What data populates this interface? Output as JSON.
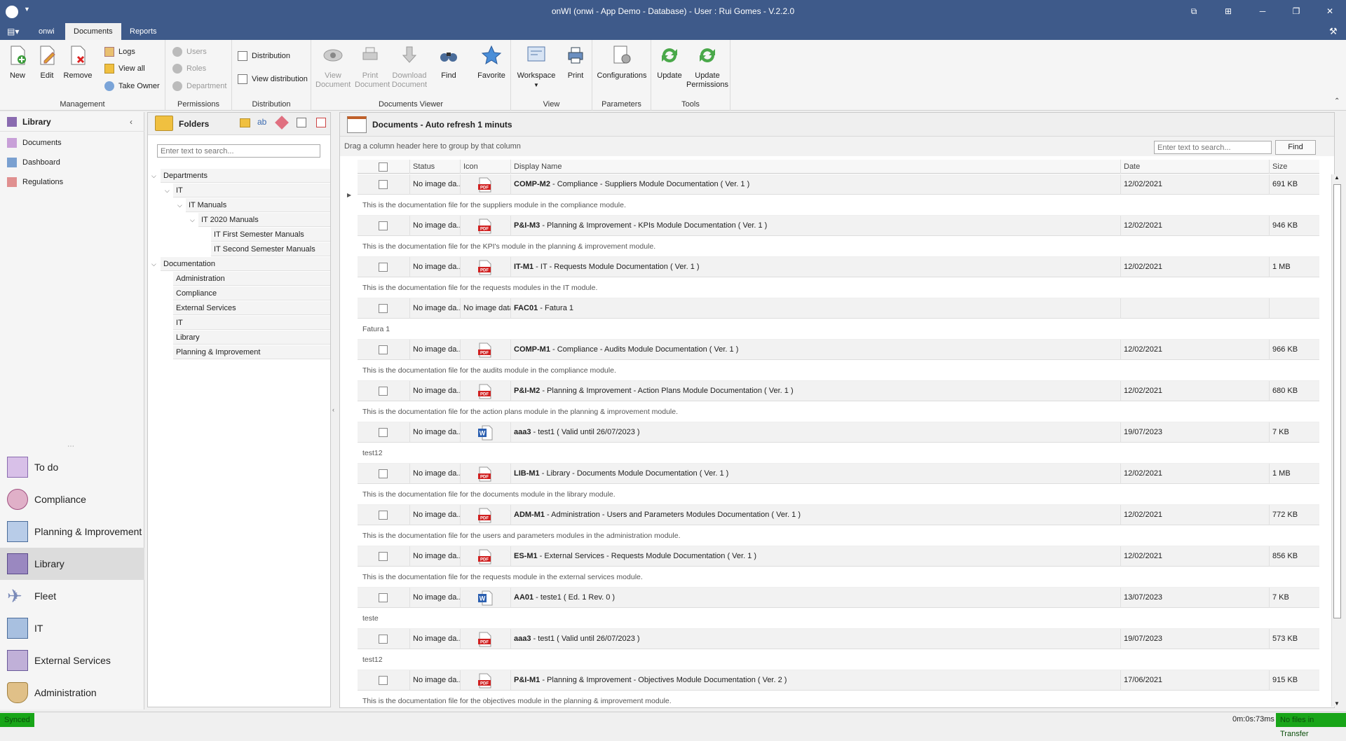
{
  "window": {
    "title": "onWI (onwi - App Demo - Database) - User : Rui Gomes - V.2.2.0"
  },
  "menu_tabs": [
    "onwi",
    "Documents",
    "Reports"
  ],
  "ribbon": {
    "management": {
      "name": "Management",
      "new": "New",
      "edit": "Edit",
      "remove": "Remove",
      "logs": "Logs",
      "view_all": "View all",
      "take_owner": "Take Owner"
    },
    "permissions": {
      "name": "Permissions",
      "users": "Users",
      "roles": "Roles",
      "department": "Department"
    },
    "distribution": {
      "name": "Distribution",
      "distribution": "Distribution",
      "view_distribution": "View distribution"
    },
    "viewer": {
      "name": "Documents Viewer",
      "view": "View\nDocument",
      "print": "Print\nDocument",
      "download": "Download\nDocument",
      "find": "Find",
      "favorite": "Favorite"
    },
    "view": {
      "name": "View",
      "workspace": "Workspace",
      "print": "Print"
    },
    "parameters": {
      "name": "Parameters",
      "configurations": "Configurations"
    },
    "tools": {
      "name": "Tools",
      "update": "Update",
      "update_permissions": "Update\nPermissions"
    }
  },
  "library": {
    "title": "Library",
    "items": [
      "Documents",
      "Dashboard",
      "Regulations"
    ]
  },
  "nav": [
    "To do",
    "Compliance",
    "Planning & Improvement",
    "Library",
    "Fleet",
    "IT",
    "External Services",
    "Administration"
  ],
  "folders": {
    "title": "Folders",
    "search_placeholder": "Enter text to search...",
    "tree": [
      "Departments",
      "IT",
      "IT Manuals",
      "IT 2020 Manuals",
      "IT First Semester Manuals",
      "IT Second Semester Manuals",
      "Documentation",
      "Administration",
      "Compliance",
      "External Services",
      "IT",
      "Library",
      "Planning & Improvement"
    ]
  },
  "documents": {
    "title": "Documents - Auto refresh 1 minuts",
    "group_hint": "Drag a column header here to group by that column",
    "search_placeholder": "Enter text to search...",
    "find": "Find",
    "columns": [
      "Status",
      "Icon",
      "Display Name",
      "Date",
      "Size"
    ],
    "rows": [
      {
        "status": "No image da...",
        "icon": "pdf",
        "code": "COMP-M2",
        "name": " - Compliance - Suppliers Module Documentation ( Ver. 1 )",
        "date": "12/02/2021",
        "size": "691 KB",
        "desc": "This is the documentation file for the suppliers module in the compliance module."
      },
      {
        "status": "No image da...",
        "icon": "pdf",
        "code": "P&I-M3",
        "name": " - Planning & Improvement - KPIs Module Documentation ( Ver. 1 )",
        "date": "12/02/2021",
        "size": "946 KB",
        "desc": "This is the documentation file for the KPI's module in the planning & improvement module."
      },
      {
        "status": "No image da...",
        "icon": "pdf",
        "code": "IT-M1",
        "name": " - IT - Requests Module Documentation ( Ver. 1 )",
        "date": "12/02/2021",
        "size": "1 MB",
        "desc": "This is the documentation file for the requests modules in the IT module."
      },
      {
        "status": "No image da...",
        "icon": "none",
        "icon_text": "No image data",
        "code": "FAC01",
        "name": " - Fatura 1",
        "date": "",
        "size": "",
        "desc": "Fatura 1"
      },
      {
        "status": "No image da...",
        "icon": "pdf",
        "code": "COMP-M1",
        "name": " - Compliance - Audits Module Documentation ( Ver. 1 )",
        "date": "12/02/2021",
        "size": "966 KB",
        "desc": "This is the documentation file for the audits module in the compliance module."
      },
      {
        "status": "No image da...",
        "icon": "pdf",
        "code": "P&I-M2",
        "name": " - Planning & Improvement - Action Plans Module Documentation ( Ver. 1 )",
        "date": "12/02/2021",
        "size": "680 KB",
        "desc": "This is the documentation file for the action plans module in the planning & improvement module."
      },
      {
        "status": "No image da...",
        "icon": "word",
        "code": "aaa3",
        "name": " - test1 ( Valid until 26/07/2023 )",
        "date": "19/07/2023",
        "size": "7 KB",
        "desc": "test12"
      },
      {
        "status": "No image da...",
        "icon": "pdf",
        "code": "LIB-M1",
        "name": " - Library - Documents Module Documentation ( Ver. 1 )",
        "date": "12/02/2021",
        "size": "1 MB",
        "desc": "This is the documentation file for the documents module in the library module."
      },
      {
        "status": "No image da...",
        "icon": "pdf",
        "code": "ADM-M1",
        "name": " - Administration - Users and Parameters Modules Documentation ( Ver. 1 )",
        "date": "12/02/2021",
        "size": "772 KB",
        "desc": "This is the documentation file for the users and parameters modules in the administration module."
      },
      {
        "status": "No image da...",
        "icon": "pdf",
        "code": "ES-M1",
        "name": " - External Services - Requests Module Documentation ( Ver. 1 )",
        "date": "12/02/2021",
        "size": "856 KB",
        "desc": "This is the documentation file for the requests module in the external services module."
      },
      {
        "status": "No image da...",
        "icon": "word",
        "code": "AA01",
        "name": " - teste1 ( Ed. 1 Rev. 0 )",
        "date": "13/07/2023",
        "size": "7 KB",
        "desc": "teste"
      },
      {
        "status": "No image da...",
        "icon": "pdf",
        "code": "aaa3",
        "name": " - test1 ( Valid until 26/07/2023 )",
        "date": "19/07/2023",
        "size": "573 KB",
        "desc": "test12"
      },
      {
        "status": "No image da...",
        "icon": "pdf",
        "code": "P&I-M1",
        "name": " - Planning & Improvement - Objectives Module Documentation ( Ver. 2 )",
        "date": "17/06/2021",
        "size": "915 KB",
        "desc": "This is the documentation file for the objectives module in the planning & improvement module."
      }
    ]
  },
  "status": {
    "left": "Synced",
    "time": "0m:0s:73ms",
    "transfer": "No files in Transfer"
  }
}
